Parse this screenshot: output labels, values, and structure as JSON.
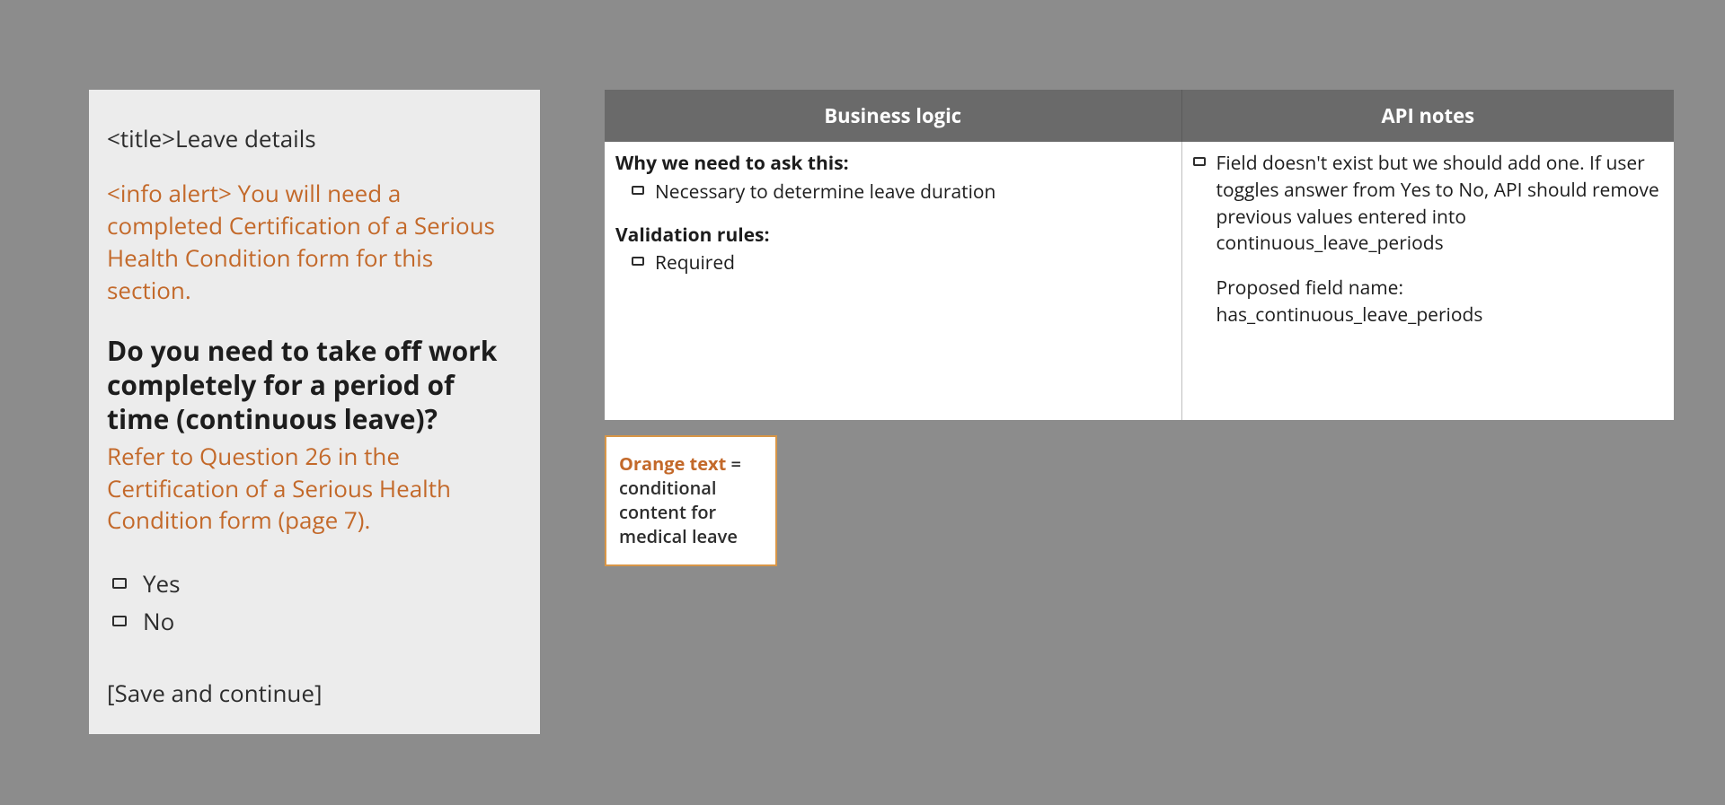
{
  "spec": {
    "title_prefix": "<title>",
    "title_text": "Leave details",
    "info_prefix": "<info alert> ",
    "info_text": "You will need a completed Certification of a Serious Health Condition form for this section.",
    "question": "Do you need to take off work completely for a period of time (continuous leave)?",
    "hint": "Refer to Question 26 in the Certification of a Serious Health Condition form (page 7).",
    "options": {
      "yes": "Yes",
      "no": "No"
    },
    "save_button": "[Save and continue]"
  },
  "table": {
    "headers": {
      "business_logic": "Business logic",
      "api_notes": "API notes"
    },
    "business_logic": {
      "why_heading": "Why we need to ask this:",
      "why_item": "Necessary to determine leave duration",
      "validation_heading": "Validation rules:",
      "validation_item": "Required"
    },
    "api_notes": {
      "para1": "Field doesn't exist but we should add one.  If user toggles answer from Yes to No, API should remove previous values entered into continuous_leave_periods",
      "para2": "Proposed field name: has_continuous_leave_periods"
    }
  },
  "legend": {
    "orange_label": "Orange text",
    "equals": " = ",
    "description": "conditional content for medical leave"
  }
}
